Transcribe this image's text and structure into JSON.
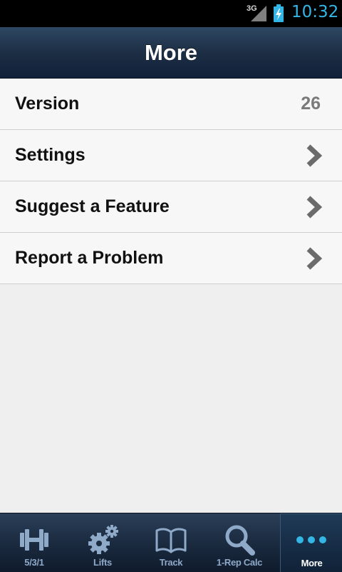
{
  "status_bar": {
    "network": "3G",
    "time": "10:32"
  },
  "header": {
    "title": "More"
  },
  "menu": {
    "items": [
      {
        "label": "Version",
        "value": "26"
      },
      {
        "label": "Settings"
      },
      {
        "label": "Suggest a Feature"
      },
      {
        "label": "Report a Problem"
      }
    ]
  },
  "tabs": [
    {
      "label": "5/3/1",
      "icon": "barbell-icon"
    },
    {
      "label": "Lifts",
      "icon": "gears-icon"
    },
    {
      "label": "Track",
      "icon": "book-icon"
    },
    {
      "label": "1-Rep Calc",
      "icon": "search-icon"
    },
    {
      "label": "More",
      "icon": "ellipsis-icon",
      "selected": true
    }
  ],
  "colors": {
    "accent": "#33b5e5",
    "header": "#1c2e44",
    "tab_inactive": "#8fa9c8"
  }
}
